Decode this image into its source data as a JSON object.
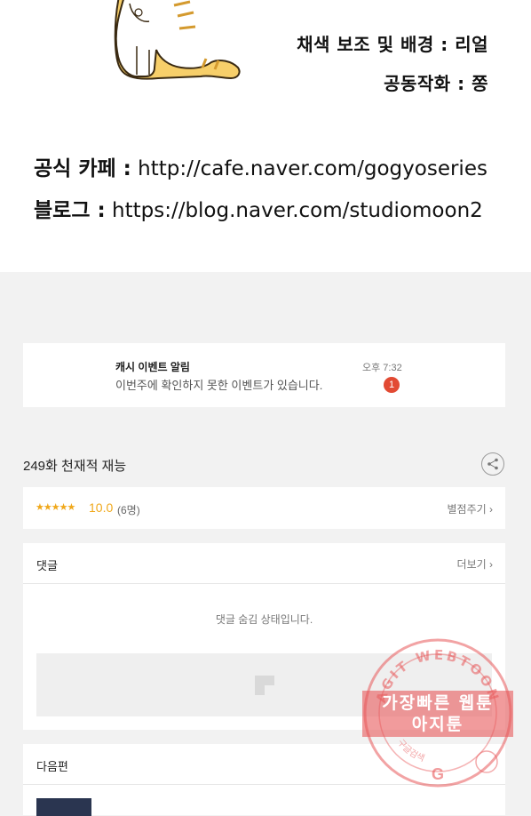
{
  "artwork": {
    "credits": [
      "채색 보조 및 배경 : 리얼",
      "공동작화 : 쫑"
    ],
    "links": [
      {
        "label": "공식 카페 :",
        "url": "http://cafe.naver.com/gogyoseries"
      },
      {
        "label": "블로그 :",
        "url": "https://blog.naver.com/studiomoon2"
      }
    ]
  },
  "notification": {
    "title": "캐시 이벤트 알림",
    "message": "이번주에 확인하지 못한 이벤트가 있습니다.",
    "time": "오후 7:32",
    "badge": "1"
  },
  "episode": {
    "title": "249화 천재적 재능"
  },
  "rating": {
    "stars": "★★★★★",
    "score": "10.0",
    "count": "(6명)",
    "rate_label": "별점주기 ›"
  },
  "comments": {
    "heading": "댓글",
    "more_label": "더보기 ›",
    "hidden_message": "댓글 숨김 상태입니다."
  },
  "next_episode": {
    "heading": "다음편"
  },
  "watermark": {
    "top_text": "AGIT WEBTOON",
    "line1": "가장빠른 웹툰",
    "line2": "아지툰",
    "bottom_text": "구글검색"
  },
  "colors": {
    "accent_star": "#f0a81b",
    "badge": "#e24a33",
    "watermark": "#e8585a"
  }
}
